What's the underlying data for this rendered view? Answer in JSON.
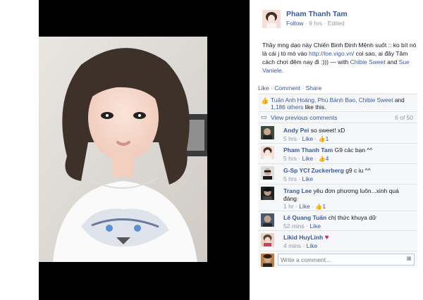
{
  "post": {
    "author": "Pham Thanh Tam",
    "follow_label": "Follow",
    "time": "9 hrs",
    "edited": "Edited",
    "text_part1": "Thầy mng dạo này Chiến Binh Định Mệnh suốt :: ko bít nó là cái j tò mò vào",
    "link": "http://loe.vigo.vn/",
    "text_part2": "coi sao, ai đây Tâm cách chơi đêm nay đi :))) — with",
    "tag1": "Chibie Sweet",
    "and": "and",
    "tag2": "Sue Vaniele",
    "period": "."
  },
  "actions": {
    "like": "Like",
    "comment": "Comment",
    "share": "Share"
  },
  "likes": {
    "names": "Tuấn Anh Hoàng, Phú Bánh Bao, Chibie Sweet",
    "and": "and",
    "others": "1,186 others",
    "suffix": "like this."
  },
  "view_previous": {
    "label": "View previous comments",
    "count": "6 of 50"
  },
  "comments": [
    {
      "author": "Andy Pei",
      "text": "so sweet! xD",
      "time": "5 hrs",
      "like": "Like",
      "likes": "1"
    },
    {
      "author": "Pham Thanh Tam",
      "text": "G9 các bạn ^^",
      "time": "5 hrs",
      "like": "Like",
      "likes": "4"
    },
    {
      "author": "G-Sp YCf Zuckerberg",
      "text": "g9 c iu ^^",
      "time": "5 hrs",
      "like": "Like",
      "likes": ""
    },
    {
      "author": "Trang Lee",
      "text": "yêu đơn phương luôn...xinh quá đáng",
      "time": "1 hr",
      "like": "Like",
      "likes": "1"
    },
    {
      "author": "Lê Quang Tuấn",
      "text": "chị thức khuya dữ",
      "time": "52 mins",
      "like": "Like",
      "likes": ""
    },
    {
      "author": "Likid HuyLinh",
      "text": "",
      "time": "4 mins",
      "like": "Like",
      "likes": ""
    }
  ],
  "composer": {
    "placeholder": "Write a comment..."
  },
  "colors": {
    "link": "#3b5998",
    "meta": "#9197a3",
    "heart": "#e0245e"
  }
}
